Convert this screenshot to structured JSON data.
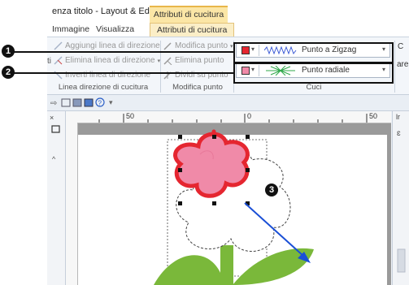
{
  "window": {
    "title": "enza titolo - Layout & Editing",
    "contextual_tab_header": "Attributi di cucitura"
  },
  "tabs": [
    {
      "label": "Immagine"
    },
    {
      "label": "Visualizza"
    },
    {
      "label": "Attributi di cucitura"
    }
  ],
  "ribbon": {
    "direction_group": {
      "add_label": "Aggiungi linea di direzione",
      "delete_label": "Elimina linea di direzione",
      "invert_label": "Inverti linea di direzione",
      "group_label": "Linea direzione di cucitura",
      "edge_letter": "ti"
    },
    "modify_group": {
      "modify_label": "Modifica punto",
      "delete_label": "Elimina punto",
      "split_label": "Dividi su punto",
      "group_label": "Modifica punto"
    },
    "stitches_group": {
      "row1": {
        "color": "#e52630",
        "label": "Punto a Zigzag",
        "pattern_icon": "zigzag-pattern-icon"
      },
      "row2": {
        "color": "#f08aa8",
        "label": "Punto radiale",
        "pattern_icon": "radial-pattern-icon"
      },
      "group_label": "Cuci"
    },
    "right_edge_text": {
      "line1": "C",
      "line2": "are"
    }
  },
  "ruler": {
    "labels": [
      "50",
      "0",
      "50"
    ]
  },
  "callouts": {
    "one": "1",
    "two": "2",
    "three": "3"
  },
  "colors": {
    "fill_color": "#f08aa8",
    "outline_color": "#e52630",
    "leaf_color": "#7ab83a",
    "arrow_color": "#1a4fd6"
  }
}
